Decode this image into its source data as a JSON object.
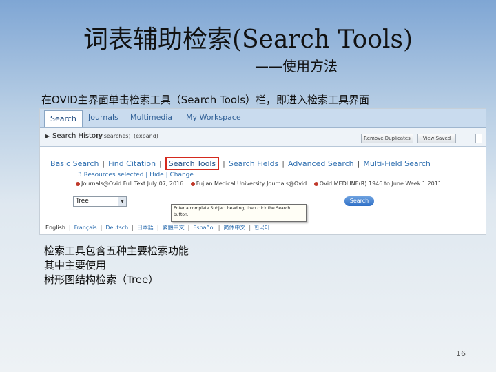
{
  "slide": {
    "title": "词表辅助检索(Search Tools)",
    "subtitle": "——使用方法",
    "caption": "在OVID主界面单击检索工具（Search Tools）栏，即进入检索工具界面",
    "notes": [
      "检索工具包含五种主要检索功能",
      "其中主要使用",
      "树形图结构检索（Tree）"
    ],
    "page_number": "16"
  },
  "ovid": {
    "top_tabs": [
      "Search",
      "Journals",
      "Multimedia",
      "My Workspace"
    ],
    "active_top_tab": "Search",
    "search_history": {
      "label": "Search History",
      "count": "(0 searches)",
      "expand": "(expand)",
      "remove_duplicates": "Remove Duplicates",
      "view_saved": "View Saved"
    },
    "sub_tabs": [
      "Basic Search",
      "Find Citation",
      "Search Tools",
      "Search Fields",
      "Advanced Search",
      "Multi-Field Search"
    ],
    "active_sub_tab": "Search Tools",
    "resources": {
      "selected": "3 Resources selected",
      "hide": "Hide",
      "change": "Change"
    },
    "databases": [
      {
        "name": "Journals@Ovid Full Text",
        "range": "July 07, 2016"
      },
      {
        "name": "Fujian Medical University Journals@Ovid",
        "range": ""
      },
      {
        "name": "Ovid MEDLINE(R)",
        "range": "1946 to June Week 1 2011"
      }
    ],
    "tool_select": {
      "value": "Tree"
    },
    "tooltip": "Enter a complete Subject heading, then click the Search button.",
    "search_button": "Search",
    "languages": [
      "English",
      "Français",
      "Deutsch",
      "日本語",
      "繁體中文",
      "Español",
      "简体中文",
      "한국어"
    ],
    "current_language": "English",
    "colors": {
      "highlight": "#d42a1e",
      "nav_bg": "#c9dbee",
      "link": "#2f6fb0",
      "search_button": "#2f6fc6"
    }
  }
}
